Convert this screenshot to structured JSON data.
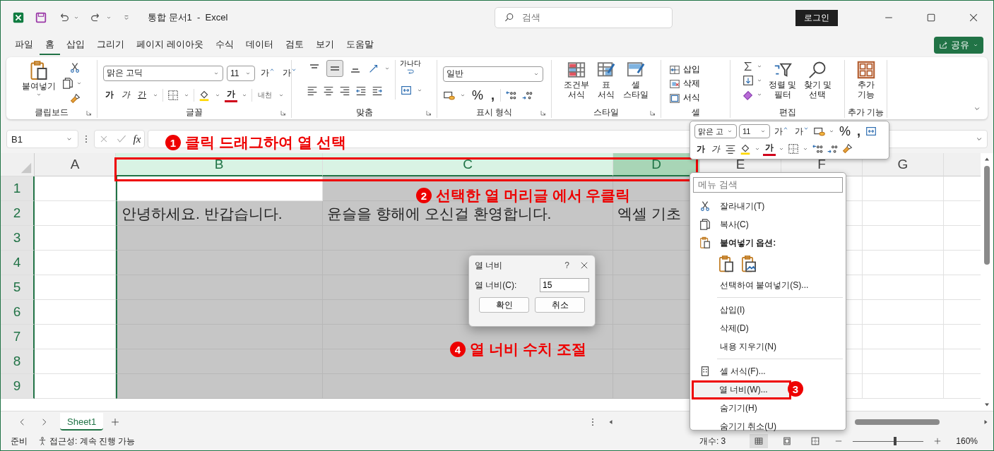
{
  "title_bar": {
    "title": "통합 문서1  -  Excel",
    "search_placeholder": "검색",
    "sign_in": "로그인"
  },
  "tabs": [
    {
      "label": "파일",
      "selected": false
    },
    {
      "label": "홈",
      "selected": true
    },
    {
      "label": "삽입",
      "selected": false
    },
    {
      "label": "그리기",
      "selected": false
    },
    {
      "label": "페이지 레이아웃",
      "selected": false
    },
    {
      "label": "수식",
      "selected": false
    },
    {
      "label": "데이터",
      "selected": false
    },
    {
      "label": "검토",
      "selected": false
    },
    {
      "label": "보기",
      "selected": false
    },
    {
      "label": "도움말",
      "selected": false
    }
  ],
  "share": "공유",
  "ribbon": {
    "clipboard": {
      "label": "클립보드",
      "paste": "붙여넣기"
    },
    "font": {
      "label": "글꼴",
      "font_name": "맑은 고딕",
      "font_size": "11",
      "grow": "가",
      "shrink": "가",
      "styles": [
        {
          "kind": "bold",
          "text": "가"
        },
        {
          "kind": "italic",
          "text": "가"
        },
        {
          "kind": "underline",
          "text": "간"
        }
      ],
      "font_color": "가",
      "phonetic": "내천"
    },
    "alignment": {
      "label": "맞춤",
      "vertical": [
        {
          "selected": false
        },
        {
          "selected": true
        },
        {
          "selected": false
        }
      ],
      "wrap": "가나다"
    },
    "number": {
      "label": "표시 형식",
      "format": "일반",
      "percent": "%",
      "comma": ","
    },
    "styles": {
      "label": "스타일",
      "buttons": [
        {
          "kind": "conditional",
          "lines": [
            "조건부",
            "서식"
          ]
        },
        {
          "kind": "table",
          "lines": [
            "표",
            "서식"
          ]
        },
        {
          "kind": "cell",
          "lines": [
            "셀",
            "스타일"
          ]
        }
      ]
    },
    "cells": {
      "label": "셀",
      "buttons": [
        {
          "kind": "insert",
          "label": "삽입"
        },
        {
          "kind": "delete",
          "label": "삭제"
        },
        {
          "kind": "format",
          "label": "서식"
        }
      ]
    },
    "editing": {
      "label": "편집",
      "buttons": [
        {
          "kind": "sort",
          "lines": [
            "정렬 및",
            "필터"
          ]
        },
        {
          "kind": "find",
          "lines": [
            "찾기 및",
            "선택"
          ]
        }
      ]
    },
    "addins": {
      "label": "추가 기능",
      "lines": [
        "추가",
        "기능"
      ]
    }
  },
  "formula_bar": {
    "name_box": "B1",
    "fx": "fx"
  },
  "columns": [
    {
      "label": "A",
      "selected": false,
      "highlighted": false
    },
    {
      "label": "B",
      "selected": true,
      "highlighted": false
    },
    {
      "label": "C",
      "selected": true,
      "highlighted": false
    },
    {
      "label": "D",
      "selected": true,
      "highlighted": true
    },
    {
      "label": "E",
      "selected": false,
      "highlighted": false
    },
    {
      "label": "F",
      "selected": false,
      "highlighted": false
    },
    {
      "label": "G",
      "selected": false,
      "highlighted": false
    }
  ],
  "rows": [
    {
      "number": "1",
      "highlighted": true,
      "cells": [
        {},
        {
          "active": true
        }
      ]
    },
    {
      "number": "2",
      "highlighted": true,
      "cells": [
        {},
        {
          "text": "안녕하세요. 반갑습니다."
        },
        {
          "text": "윤슬을 향해에 오신걸 환영합니다."
        },
        {
          "text": "엑셀 기초"
        }
      ]
    },
    {
      "number": "3",
      "highlighted": true
    },
    {
      "number": "4",
      "highlighted": true
    },
    {
      "number": "5",
      "highlighted": true
    },
    {
      "number": "6",
      "highlighted": true
    },
    {
      "number": "7",
      "highlighted": true
    },
    {
      "number": "8",
      "highlighted": true
    },
    {
      "number": "9",
      "highlighted": true
    }
  ],
  "sheet_tabs": [
    {
      "label": "Sheet1",
      "selected": true
    }
  ],
  "status_bar": {
    "ready": "준비",
    "accessibility": "접근성: 계속 진행 가능",
    "count": "개수: 3",
    "zoom_slider": {
      "level": 0.6
    },
    "zoom": "160%"
  },
  "dialog": {
    "title": "열 너비",
    "help": "?",
    "field_label": "열 너비(C):",
    "value": "15",
    "buttons": [
      "확인",
      "취소"
    ]
  },
  "context_menu": {
    "search_placeholder": "메뉴 검색",
    "items": [
      {
        "kind": "cut",
        "label": "잘라내기(T)",
        "selected": false
      },
      {
        "kind": "copy",
        "label": "복사(C)",
        "selected": false
      },
      {
        "kind": "header",
        "label": "붙여넣기 옵션:"
      },
      {
        "kind": "paste_options"
      },
      {
        "kind": "command",
        "label": "선택하여 붙여넣기(S)...",
        "selected": false
      },
      {
        "kind": "separator"
      },
      {
        "kind": "command",
        "label": "삽입(I)",
        "selected": false
      },
      {
        "kind": "command",
        "label": "삭제(D)",
        "selected": false
      },
      {
        "kind": "command",
        "label": "내용 지우기(N)",
        "selected": false
      },
      {
        "kind": "separator"
      },
      {
        "kind": "format",
        "label": "셀 서식(F)...",
        "selected": false
      },
      {
        "kind": "command",
        "label": "열 너비(W)...",
        "selected": true
      },
      {
        "kind": "command",
        "label": "숨기기(H)",
        "selected": false
      },
      {
        "kind": "command",
        "label": "숨기기 취소(U)",
        "selected": false
      }
    ]
  },
  "mini_toolbar": {
    "font_name": "맑은 고",
    "font_size": "11",
    "grow": "가",
    "shrink": "가",
    "percent": "%",
    "comma": ",",
    "bold": "가",
    "italic": "가",
    "font_color": "가"
  },
  "annotations": [
    {
      "number": "1",
      "text": "클릭 드래그하여 열 선택"
    },
    {
      "number": "2",
      "text": "선택한 열 머리글 에서 우클릭"
    },
    {
      "number": "3"
    },
    {
      "number": "4",
      "text": "열 너비 수치 조절"
    }
  ]
}
